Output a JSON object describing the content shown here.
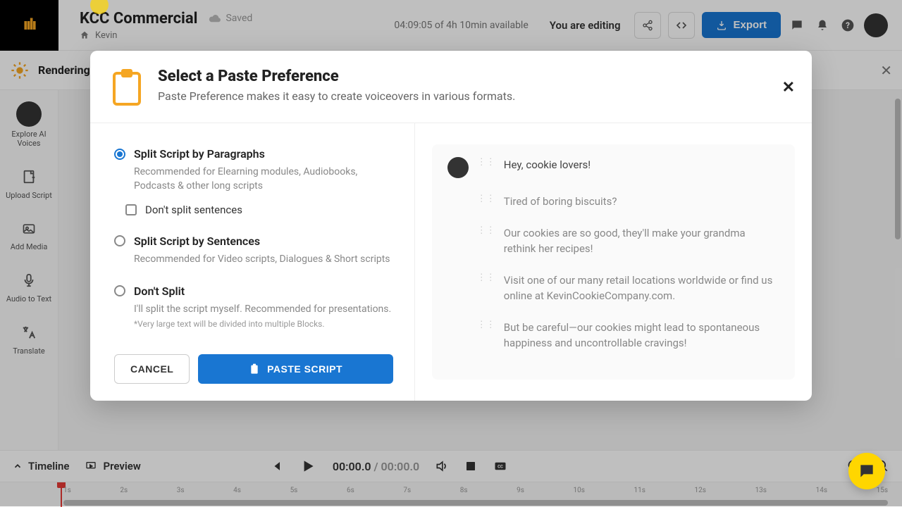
{
  "header": {
    "project_title": "KCC Commercial",
    "saved_label": "Saved",
    "breadcrumb_user": "Kevin",
    "time_available": "04:09:05 of 4h 10min available",
    "editing_label": "You are editing",
    "export_label": "Export"
  },
  "render_bar": {
    "label": "Rendering"
  },
  "sidebar": {
    "items": [
      {
        "label": "Explore AI Voices"
      },
      {
        "label": "Upload Script"
      },
      {
        "label": "Add Media"
      },
      {
        "label": "Audio to Text"
      },
      {
        "label": "Translate"
      }
    ]
  },
  "bottom": {
    "timeline_label": "Timeline",
    "preview_label": "Preview",
    "time_current": "00:00.0",
    "time_total": " / 00:00.0",
    "ticks": [
      "1s",
      "2s",
      "3s",
      "4s",
      "5s",
      "6s",
      "7s",
      "8s",
      "9s",
      "10s",
      "11s",
      "12s",
      "13s",
      "14s",
      "15s"
    ]
  },
  "modal": {
    "title": "Select a Paste Preference",
    "subtitle": "Paste Preference makes it easy to create voiceovers in various formats.",
    "options": [
      {
        "label": "Split Script by Paragraphs",
        "desc": "Recommended for Elearning modules, Audiobooks, Podcasts & other long scripts",
        "checkbox_label": "Don't split sentences"
      },
      {
        "label": "Split Script by Sentences",
        "desc": "Recommended for Video scripts, Dialogues & Short scripts"
      },
      {
        "label": "Don't Split",
        "desc": "I'll split the script myself. Recommended for presentations.",
        "note": "*Very large text will be divided into multiple Blocks."
      }
    ],
    "cancel_label": "CANCEL",
    "paste_label": "PASTE SCRIPT",
    "preview_lines": [
      "Hey, cookie lovers!",
      "Tired of boring biscuits?",
      "Our cookies are so good, they'll make your grandma rethink her recipes!",
      "Visit one of our many retail locations worldwide or find us online at KevinCookieCompany.com.",
      "But be careful—our cookies might lead to spontaneous happiness and uncontrollable cravings!"
    ]
  }
}
